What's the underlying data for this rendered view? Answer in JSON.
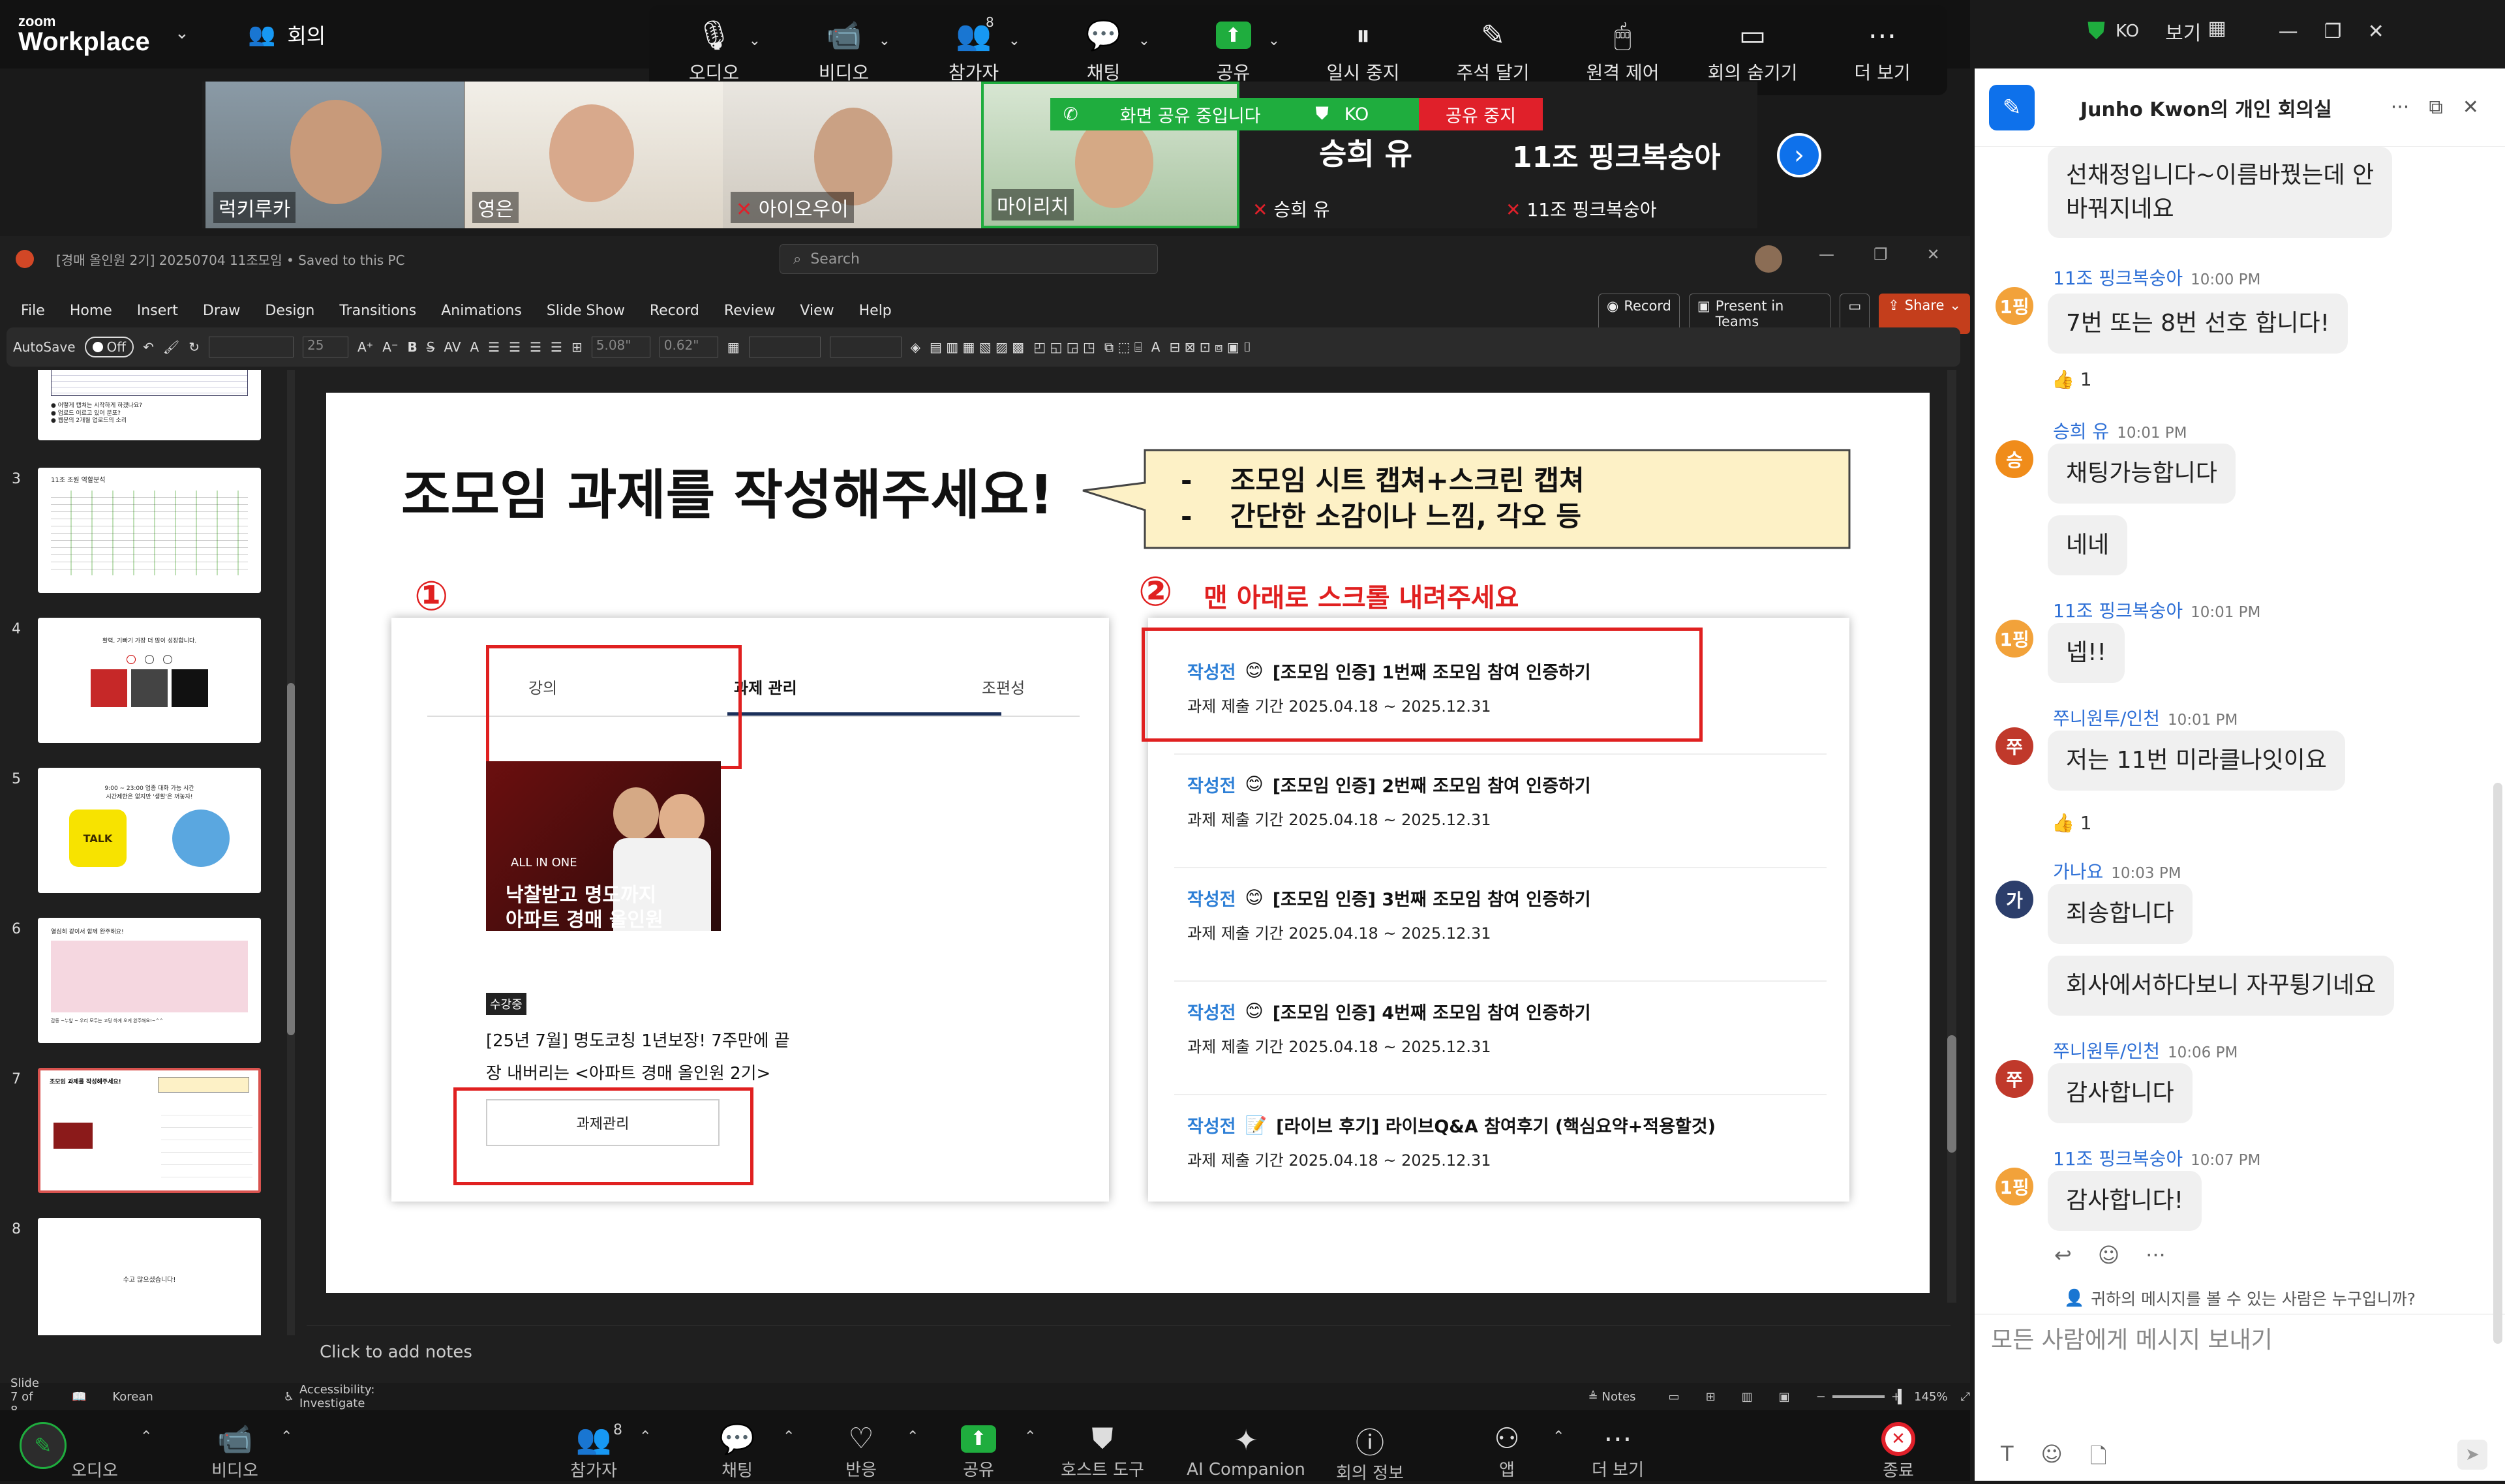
{
  "zoom_app": {
    "brand_line1": "zoom",
    "brand_line2": "Workplace",
    "meeting_label": "회의"
  },
  "top_controls": [
    {
      "label": "오디오",
      "icon": "microphone-icon"
    },
    {
      "label": "비디오",
      "icon": "video-camera-icon"
    },
    {
      "label": "참가자",
      "icon": "participants-icon",
      "count": "8"
    },
    {
      "label": "채팅",
      "icon": "chat-icon"
    },
    {
      "label": "공유",
      "icon": "share-screen-icon"
    },
    {
      "label": "일시 중지",
      "icon": "pause-icon"
    },
    {
      "label": "주석 달기",
      "icon": "pencil-icon"
    },
    {
      "label": "원격 제어",
      "icon": "mouse-icon"
    },
    {
      "label": "회의 숨기기",
      "icon": "hide-meeting-icon"
    },
    {
      "label": "더 보기",
      "icon": "more-icon"
    }
  ],
  "window_controls": {
    "lang": "KO",
    "view_label": "보기"
  },
  "share_banner": {
    "status": "화면 공유 중입니다",
    "lang": "KO",
    "stop": "공유 중지"
  },
  "video_tiles": [
    "럭키루카",
    "영은",
    "아이오우이",
    "마이리치"
  ],
  "name_tiles": [
    {
      "big": "승희 유",
      "small": "승희 유"
    },
    {
      "big": "11조 핑크복숭아",
      "small": "11조 핑크복숭아"
    }
  ],
  "ppt": {
    "title": "[경매 올인원 2기] 20250704 11조모임 • Saved to this PC",
    "search_placeholder": "Search",
    "menu": [
      "File",
      "Home",
      "Insert",
      "Draw",
      "Design",
      "Transitions",
      "Animations",
      "Slide Show",
      "Record",
      "Review",
      "View",
      "Help"
    ],
    "record_btn": "Record",
    "present_btn": "Present in Teams",
    "share_btn": "Share",
    "autosave_label": "AutoSave",
    "autosave_state": "Off",
    "font_size": "25",
    "ribbon_field1": "5.08\"",
    "ribbon_field2": "0.62\"",
    "notes_placeholder": "Click to add notes",
    "status_slide": "Slide 7 of 8",
    "status_lang": "Korean",
    "status_accessibility": "Accessibility: Investigate",
    "status_notes": "Notes",
    "zoom_level": "145%",
    "thumb_numbers": [
      "3",
      "4",
      "5",
      "6",
      "7",
      "8"
    ],
    "thumb_texts": {
      "t2_lines": [
        "● 어떻게 캡쳐는 시작하게 하겠나요?",
        "● 업로드 이르고 있어 분포?",
        "● 웹문의 2개월 업로드의 소리"
      ],
      "t3_title": "11조 조원 역할분석",
      "t4_title": "활력, 기빠기 가장 더 많이 성장합니다.",
      "t5_title": "9:00 ~ 23:00 업종 대화 가능 시간",
      "t5_sub": "시간제한은 없지만 '생활'은 꺼놓자!",
      "t5_kakao": "TALK",
      "t6_title": "열심히 같이서 함께 완주해요!",
      "t6_sub": "감동 ~누앞 ~ 우리 모두는 고딩 하게 오게 완주해요!~^^",
      "t7_title": "조모임 과제를 작성해주세요!",
      "t8_text": "수고 많으셨습니다!"
    }
  },
  "slide": {
    "heading": "조모임 과제를 작성해주세요!",
    "callout_items": [
      "-    조모임 시트 캡쳐+스크린 캡쳐",
      "-    간단한 소감이나 느낌, 각오 등"
    ],
    "step1": "①",
    "step2": "②",
    "step2_text": "맨 아래로 스크롤 내려주세요",
    "left_tabs": [
      "강의",
      "과제 관리",
      "조편성"
    ],
    "course_badge": "수강중",
    "course_title_l1": "[25년 7월] 명도코칭 1년보장! 7주만에 끝",
    "course_title_l2": "장 내버리는 <아파트 경매 올인원 2기>",
    "course_button": "과제관리",
    "thumb_tag": "ALL IN ONE",
    "thumb_l1": "낙찰받고 명도까지",
    "thumb_l2": "아파트 경매 올인원",
    "tasks": [
      {
        "status": "작성전",
        "title": "[조모임 인증] 1번째 조모임 참여 인증하기",
        "period": "과제 제출 기간  2025.04.18 ~ 2025.12.31"
      },
      {
        "status": "작성전",
        "title": "[조모임 인증] 2번째 조모임 참여 인증하기",
        "period": "과제 제출 기간  2025.04.18 ~ 2025.12.31"
      },
      {
        "status": "작성전",
        "title": "[조모임 인증] 3번째 조모임 참여 인증하기",
        "period": "과제 제출 기간  2025.04.18 ~ 2025.12.31"
      },
      {
        "status": "작성전",
        "title": "[조모임 인증] 4번째 조모임 참여 인증하기",
        "period": "과제 제출 기간  2025.04.18 ~ 2025.12.31"
      },
      {
        "status": "작성전",
        "title": "[라이브 후기] 라이브Q&A 참여후기 (핵심요약+적용할것)",
        "period": "과제 제출 기간  2025.04.18 ~ 2025.12.31"
      }
    ]
  },
  "bottom_toolbar": [
    {
      "label": "오디오",
      "icon": "microphone-icon"
    },
    {
      "label": "비디오",
      "icon": "video-camera-icon"
    },
    {
      "label": "참가자",
      "icon": "participants-icon",
      "count": "8"
    },
    {
      "label": "채팅",
      "icon": "chat-icon"
    },
    {
      "label": "반응",
      "icon": "heart-icon"
    },
    {
      "label": "공유",
      "icon": "share-screen-icon"
    },
    {
      "label": "호스트 도구",
      "icon": "shield-icon"
    },
    {
      "label": "AI Companion",
      "icon": "sparkle-icon"
    },
    {
      "label": "회의 정보",
      "icon": "info-icon"
    },
    {
      "label": "앱",
      "icon": "apps-icon"
    },
    {
      "label": "더 보기",
      "icon": "more-icon"
    },
    {
      "label": "종료",
      "icon": "end-icon"
    }
  ],
  "chat": {
    "title": "Junho Kwon의 개인 회의실",
    "messages": [
      {
        "id": "m0",
        "text_l1": "선채정입니다~이름바꿨는데 안",
        "text_l2": "바꿔지네요"
      },
      {
        "id": "m1",
        "sender": "11조 핑크복숭아",
        "time": "10:00 PM",
        "avatar": "1핑",
        "text": "7번 또는 8번 선호 합니다!",
        "reaction": "1"
      },
      {
        "id": "m2",
        "sender": "승희 유",
        "time": "10:01 PM",
        "avatar": "승",
        "text": "채팅가능합니다",
        "text2": "네네"
      },
      {
        "id": "m3",
        "sender": "11조 핑크복숭아",
        "time": "10:01 PM",
        "avatar": "1핑",
        "text": "넵!!"
      },
      {
        "id": "m4",
        "sender": "쭈니원투/인천",
        "time": "10:01 PM",
        "avatar": "쭈",
        "text": "저는 11번 미라클나잇이요",
        "reaction": "1"
      },
      {
        "id": "m5",
        "sender": "가나요",
        "time": "10:03 PM",
        "avatar": "가",
        "text": "죄송합니다",
        "text2": "회사에서하다보니 자꾸튕기네요"
      },
      {
        "id": "m6",
        "sender": "쭈니원투/인천",
        "time": "10:06 PM",
        "avatar": "쭈",
        "text": "감사합니다"
      },
      {
        "id": "m7",
        "sender": "11조 핑크복숭아",
        "time": "10:07 PM",
        "avatar": "1핑",
        "text": "감사합니다!"
      }
    ],
    "visibility_note": "귀하의 메시지를 볼 수 있는 사람은 누구입니까?",
    "input_placeholder": "모든 사람에게 메시지 보내기",
    "colors": {
      "sender": "#2d6fd6",
      "avatar_pink": "#f2a23a",
      "avatar_orange": "#f08c1a",
      "avatar_red": "#c0392b",
      "avatar_navy": "#2c3e6b"
    }
  }
}
